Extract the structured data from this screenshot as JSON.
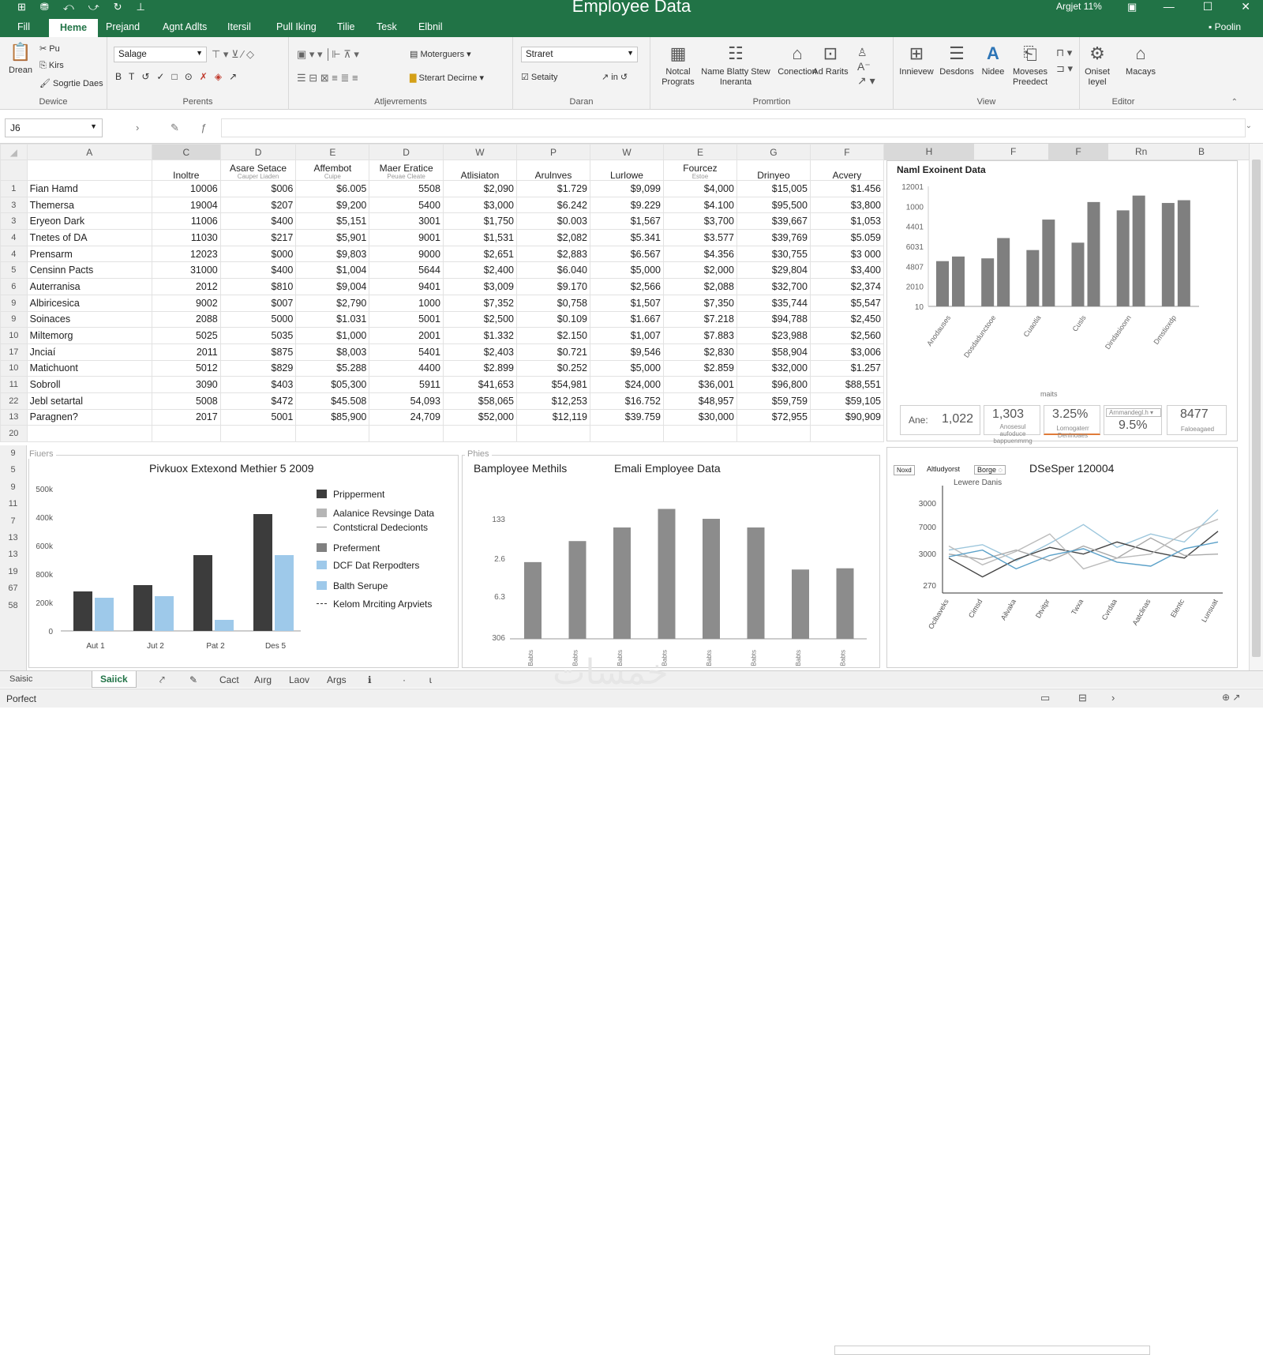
{
  "window": {
    "title": "Employee Data",
    "user": "Argjet 11%",
    "minimize": "—",
    "maximize": "☐",
    "close": "✕"
  },
  "tabs": [
    "Fill",
    "Heme",
    "Prejand",
    "Agnt Adlts",
    "Itersil",
    "Pull Iking",
    "Tilie",
    "Tesk",
    "Elbnil"
  ],
  "share_label": "Poolin",
  "ribbon": {
    "device": {
      "label": "Dewice",
      "paste": "Drean",
      "items": [
        "Pu",
        "Kirs",
        "Sogrtie Daes"
      ]
    },
    "fonts": {
      "label": "Perents",
      "font_name": "Salage",
      "tools": [
        "B",
        "T",
        "↺",
        "✓",
        "□",
        "⊙",
        "✗",
        "◈",
        "↗"
      ]
    },
    "alignment": {
      "label": "Atljevrements",
      "merge": "Moterguers",
      "format": "Sterart Decirne"
    },
    "number": {
      "label": "Daran",
      "format_combo": "Straret",
      "setting": "Setaity",
      "inc": "in"
    },
    "promotion": {
      "label": "Promrtion",
      "buttons": [
        "Notcal Prograts",
        "Name Blatty Stew Ineranta",
        "Conection",
        "Ad Rarits"
      ]
    },
    "view": {
      "label": "View",
      "buttons": [
        "Innievew",
        "Desdons",
        "Nidee",
        "Moveses Preedect"
      ]
    },
    "editor": {
      "label": "Editor",
      "buttons": [
        "Oniset Ieyel",
        "Macays"
      ]
    }
  },
  "formula_bar": {
    "name_box": "J6",
    "value": ""
  },
  "grid": {
    "columns": [
      "A",
      "C",
      "D",
      "E",
      "D",
      "W",
      "P",
      "W",
      "E",
      "G",
      "F"
    ],
    "headers": [
      {
        "title": "",
        "sub": ""
      },
      {
        "title": "Inoltre",
        "sub": ""
      },
      {
        "title": "Asare Setace",
        "sub": "Cauper Liaden"
      },
      {
        "title": "Affembot",
        "sub": "Cuipe"
      },
      {
        "title": "Maer Eratice",
        "sub": "Peuae Cleate"
      },
      {
        "title": "Atlisiaton",
        "sub": ""
      },
      {
        "title": "Arulnves",
        "sub": ""
      },
      {
        "title": "Lurlowe",
        "sub": ""
      },
      {
        "title": "Fourcez",
        "sub": "Estoe"
      },
      {
        "title": "Drinyeo",
        "sub": ""
      },
      {
        "title": "Acvery",
        "sub": ""
      }
    ],
    "rows": [
      {
        "n": "1",
        "cells": [
          "Fian Hamd",
          "10006",
          "$006",
          "$6.005",
          "5508",
          "$2,090",
          "$1.729",
          "$9,099",
          "$4,000",
          "$15,005",
          "$1.456"
        ]
      },
      {
        "n": "3",
        "cells": [
          "Themersa",
          "19004",
          "$207",
          "$9,200",
          "5400",
          "$3,000",
          "$6.242",
          "$9.229",
          "$4.100",
          "$95,500",
          "$3,800"
        ]
      },
      {
        "n": "3",
        "cells": [
          "Eryeon Dark",
          "11006",
          "$400",
          "$5,151",
          "3001",
          "$1,750",
          "$0.003",
          "$1,567",
          "$3,700",
          "$39,667",
          "$1,053"
        ]
      },
      {
        "n": "4",
        "cells": [
          "Tnetes of DA",
          "11030",
          "$217",
          "$5,901",
          "9001",
          "$1,531",
          "$2,082",
          "$5.341",
          "$3.577",
          "$39,769",
          "$5.059"
        ]
      },
      {
        "n": "4",
        "cells": [
          "Prensarm",
          "12023",
          "$000",
          "$9,803",
          "9000",
          "$2,651",
          "$2,883",
          "$6.567",
          "$4.356",
          "$30,755",
          "$3 000"
        ]
      },
      {
        "n": "5",
        "cells": [
          "Censinn Pacts",
          "31000",
          "$400",
          "$1,004",
          "5644",
          "$2,400",
          "$6.040",
          "$5,000",
          "$2,000",
          "$29,804",
          "$3,400"
        ]
      },
      {
        "n": "6",
        "cells": [
          "Auterranisa",
          "2012",
          "$810",
          "$9,004",
          "9401",
          "$3,009",
          "$9.170",
          "$2,566",
          "$2,088",
          "$32,700",
          "$2,374"
        ]
      },
      {
        "n": "9",
        "cells": [
          "Albiricesica",
          "9002",
          "$007",
          "$2,790",
          "1000",
          "$7,352",
          "$0,758",
          "$1,507",
          "$7,350",
          "$35,744",
          "$5,547"
        ]
      },
      {
        "n": "9",
        "cells": [
          "Soinaces",
          "2088",
          "5000",
          "$1.031",
          "5001",
          "$2,500",
          "$0.109",
          "$1.667",
          "$7.218",
          "$94,788",
          "$2,450"
        ]
      },
      {
        "n": "10",
        "cells": [
          "Miltemorg",
          "5025",
          "5035",
          "$1,000",
          "2001",
          "$1.332",
          "$2.150",
          "$1,007",
          "$7.883",
          "$23,988",
          "$2,560"
        ]
      },
      {
        "n": "17",
        "cells": [
          "Jnciaí",
          "2011",
          "$875",
          "$8,003",
          "5401",
          "$2,403",
          "$0.721",
          "$9,546",
          "$2,830",
          "$58,904",
          "$3,006"
        ]
      },
      {
        "n": "10",
        "cells": [
          "Matichuont",
          "5012",
          "$829",
          "$5.288",
          "4400",
          "$2.899",
          "$0.252",
          "$5,000",
          "$2.859",
          "$32,000",
          "$1.257"
        ]
      },
      {
        "n": "11",
        "cells": [
          "Sobroll",
          "3090",
          "$403",
          "$05,300",
          "5911",
          "$41,653",
          "$54,981",
          "$24,000",
          "$36,001",
          "$96,800",
          "$88,551"
        ]
      },
      {
        "n": "22",
        "cells": [
          "Jebl setartal",
          "5008",
          "$472",
          "$45.508",
          "54,093",
          "$58,065",
          "$12,253",
          "$16.752",
          "$48,957",
          "$59,759",
          "$59,105"
        ]
      },
      {
        "n": "13",
        "cells": [
          "Paragnen?",
          "2017",
          "5001",
          "$85,900",
          "24,709",
          "$52,000",
          "$12,119",
          "$39.759",
          "$30,000",
          "$72,955",
          "$90,909"
        ]
      },
      {
        "n": "20",
        "cells": [
          "",
          "",
          "",
          "",
          "",
          "",
          "",
          "",
          "",
          "",
          ""
        ]
      }
    ],
    "lower_row_numbers": [
      "9",
      "5",
      "9",
      "11",
      "7",
      "13",
      "13",
      "19",
      "67",
      "58"
    ]
  },
  "right_columns": [
    "H",
    "F",
    "F",
    "Rn",
    "B"
  ],
  "top_right_chart": {
    "title": "Naml Exoinent Data",
    "chart_data": {
      "type": "bar",
      "categories": [
        "Anodauses",
        "Dosdadunctooe",
        "Cuaotia",
        "Cusls",
        "Dindasioonn",
        "Dmstioxdp"
      ],
      "series": [
        {
          "values": [
            490,
            520,
            610,
            690,
            1040,
            1120
          ]
        },
        {
          "values": [
            540,
            740,
            940,
            1130,
            1200,
            1150
          ]
        }
      ],
      "tick_labels": [
        "12001",
        "1000",
        "4401",
        "6031",
        "4807",
        "2010",
        "10"
      ],
      "ylim": [
        0,
        1300
      ]
    }
  },
  "kpis": {
    "caption": "maits",
    "ane_label": "Ane:",
    "ane_value": "1,022",
    "k2_value": "1,303",
    "k2_sub": "Anosesul aufoduce bappuenmrng",
    "k3_value": "3.25%",
    "k3_sub": "Lornogaterr Deninoaes",
    "k4_dropdown": "Arnmandegl.h",
    "k4_value": "9.5%",
    "k5_value": "8477",
    "k5_sub": "Faloeagaed"
  },
  "chart_left": {
    "panel_label": "Fiuers",
    "title": "Pivkuox Extexond Methier 5 2009",
    "chart_data": {
      "type": "bar",
      "categories": [
        "Aut 1",
        "Jut 2",
        "Pat 2",
        "Des 5"
      ],
      "series": [
        {
          "name": "Pripperment",
          "values": [
            250,
            290,
            480,
            740
          ]
        },
        {
          "name": "Aalanice Revsinge Data",
          "values": [
            210,
            220,
            70,
            480
          ]
        }
      ],
      "tick_labels": [
        "500k",
        "400k",
        "600k",
        "800k",
        "200k",
        "0"
      ],
      "ylim": [
        0,
        900
      ]
    },
    "legend": [
      {
        "label": "Pripperment",
        "color": "#3c3c3c",
        "kind": "box"
      },
      {
        "label": "Aalanice Revsinge Data",
        "color": "#b5b5b5",
        "kind": "box"
      },
      {
        "label": "Contsticral Dedecionts",
        "color": "#999999",
        "kind": "line"
      },
      {
        "label": "Preferment",
        "color": "#808080",
        "kind": "box"
      },
      {
        "label": "DCF Dat Rerpodters",
        "color": "#9ec9ea",
        "kind": "box"
      },
      {
        "label": "Balth Serupe",
        "color": "#9ec9ea",
        "kind": "box"
      },
      {
        "label": "Kelom Mrciting Arpviets",
        "color": "#333333",
        "kind": "dash"
      }
    ]
  },
  "chart_mid": {
    "panel_label": "Phies",
    "subtitle": "Bamployee Methils",
    "title": "Emali Employee Data",
    "chart_data": {
      "type": "bar",
      "categories": [
        "Babts",
        "Babts",
        "Babts",
        "Babts",
        "Babts",
        "Babts",
        "Babts",
        "Babts"
      ],
      "values": [
        0.62,
        0.79,
        0.9,
        1.05,
        0.97,
        0.9,
        0.56,
        0.57
      ],
      "tick_labels": [
        "133",
        "2.6",
        "6.3",
        "306"
      ],
      "ylim": [
        0,
        1.2
      ]
    }
  },
  "chart_right": {
    "tab1": "Noxd",
    "tab2": "Altludyorst",
    "tab3": "Borge",
    "title": "DSeSper 120004",
    "legend": "Lewere Danis",
    "chart_data": {
      "type": "line",
      "categories": [
        "Oclbaveks",
        "Cimsd",
        "Ailvaka",
        "Dtvitpr",
        "Twxa",
        "Cvrdaa",
        "Aatclinas",
        "Elentc",
        "Lunsuat"
      ],
      "tick_labels": [
        "3000",
        "7000",
        "3000",
        "270"
      ],
      "series": [
        {
          "values": [
            3.2,
            3.6,
            2.4,
            3.7,
            5.1,
            3.4,
            4.4,
            3.8,
            6.2
          ]
        },
        {
          "values": [
            2.6,
            1.2,
            2.5,
            3.4,
            2.9,
            3.8,
            3.1,
            2.6,
            4.6
          ]
        },
        {
          "values": [
            2.9,
            2.5,
            3.2,
            2.4,
            3.5,
            2.6,
            4.1,
            2.8,
            2.9
          ]
        },
        {
          "values": [
            3.5,
            2.1,
            3.1,
            4.4,
            1.8,
            2.6,
            2.9,
            4.5,
            5.5
          ]
        },
        {
          "values": [
            2.7,
            3.2,
            1.8,
            2.8,
            3.3,
            2.3,
            2.0,
            3.3,
            3.8
          ]
        }
      ],
      "colors": [
        "#9cc6dc",
        "#444444",
        "#a9a9a9",
        "#bbbbbb",
        "#5aa0c8"
      ],
      "ylim": [
        0,
        8
      ]
    }
  },
  "sheet_tabs": {
    "left": "Saisic",
    "active": "Saiick",
    "tools": [
      "Cact",
      "Aırg",
      "Laov",
      "Args",
      "ℹ",
      "·",
      "ɩ"
    ]
  },
  "status": {
    "text": "Porfect"
  },
  "watermark": "خمسات"
}
